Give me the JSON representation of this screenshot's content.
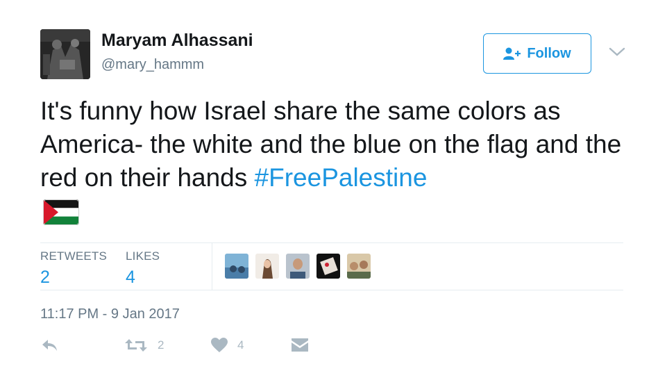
{
  "author": {
    "name": "Maryam Alhassani",
    "handle": "@mary_hammm"
  },
  "follow_button": {
    "label": "Follow"
  },
  "tweet": {
    "text": "It's funny how Israel share the same colors as America- the white and the blue on the flag and the red on their hands ",
    "hashtag": "#FreePalestine",
    "emoji": "palestine-flag"
  },
  "stats": {
    "retweets_label": "RETWEETS",
    "retweets_value": "2",
    "likes_label": "LIKES",
    "likes_value": "4"
  },
  "timestamp": "11:17 PM - 9 Jan 2017",
  "actions": {
    "retweet_count": "2",
    "like_count": "4"
  },
  "colors": {
    "link": "#1b95e0",
    "muted": "#657786",
    "action_gray": "#aab8c2",
    "divider": "#e6ecf0"
  }
}
